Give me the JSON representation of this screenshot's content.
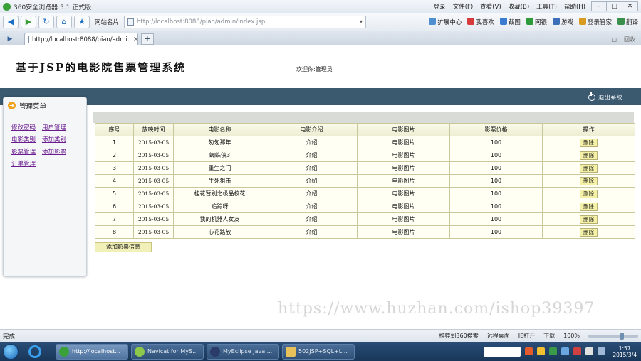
{
  "browser": {
    "title": "360安全浏览器 5.1 正式版",
    "menus": [
      "登录",
      "文件(F)",
      "查看(V)",
      "收藏(B)",
      "工具(T)",
      "帮助(H)"
    ],
    "window_buttons": [
      "–",
      "□",
      "✕"
    ],
    "nav_label": "网站名片",
    "url": "http://localhost:8088/piao/admin/index.jsp",
    "nav_right": [
      "扩展中心",
      "我喜欢",
      "截图",
      "网银",
      "游戏",
      "登录管家",
      "翻译"
    ],
    "tab_title": "http://localhost:8088/piao/admi...",
    "tab_right": [
      "□",
      "回收"
    ]
  },
  "header": {
    "system_title": "基于JSP的电影院售票管理系统",
    "welcome": "欢迎你:管理员",
    "logout": "退出系统"
  },
  "sidebar": {
    "title": "管理菜单",
    "rows": [
      [
        "修改密码",
        "用户管理"
      ],
      [
        "电影类别",
        "添加类别"
      ],
      [
        "影票管理",
        "添加影票"
      ],
      [
        "订单管理"
      ]
    ]
  },
  "table": {
    "headers": [
      "序号",
      "放映时间",
      "电影名称",
      "电影介绍",
      "电影图片",
      "影票价格",
      "操作"
    ],
    "rows": [
      [
        "1",
        "2015-03-05",
        "匆匆那年",
        "介绍",
        "电影图片",
        "100",
        "删除"
      ],
      [
        "2",
        "2015-03-05",
        "蜘蛛侠3",
        "介绍",
        "电影图片",
        "100",
        "删除"
      ],
      [
        "3",
        "2015-03-05",
        "重生之门",
        "介绍",
        "电影图片",
        "100",
        "删除"
      ],
      [
        "4",
        "2015-03-05",
        "生死狙击",
        "介绍",
        "电影图片",
        "100",
        "删除"
      ],
      [
        "5",
        "2015-03-05",
        "桂花暂别之极品校花",
        "介绍",
        "电影图片",
        "100",
        "删除"
      ],
      [
        "6",
        "2015-03-05",
        "追踪呀",
        "介绍",
        "电影图片",
        "100",
        "删除"
      ],
      [
        "7",
        "2015-03-05",
        "我的机器人女友",
        "介绍",
        "电影图片",
        "100",
        "删除"
      ],
      [
        "8",
        "2015-03-05",
        "心花路放",
        "介绍",
        "电影图片",
        "100",
        "删除"
      ]
    ]
  },
  "add_button": "添加影票信息",
  "watermark": "https://www.huzhan.com/ishop39397",
  "statusbar": {
    "status": "完成",
    "items": [
      "推荐到360搜索",
      "远程桌面",
      "IE打开",
      "下载",
      "100%"
    ]
  },
  "taskbar": {
    "tasks": [
      "http://localhost...",
      "Navicat for MyS...",
      "MyEclipse Java ...",
      "502JSP+SQL+L..."
    ],
    "time": "1:57",
    "date": "2015/3/4"
  }
}
